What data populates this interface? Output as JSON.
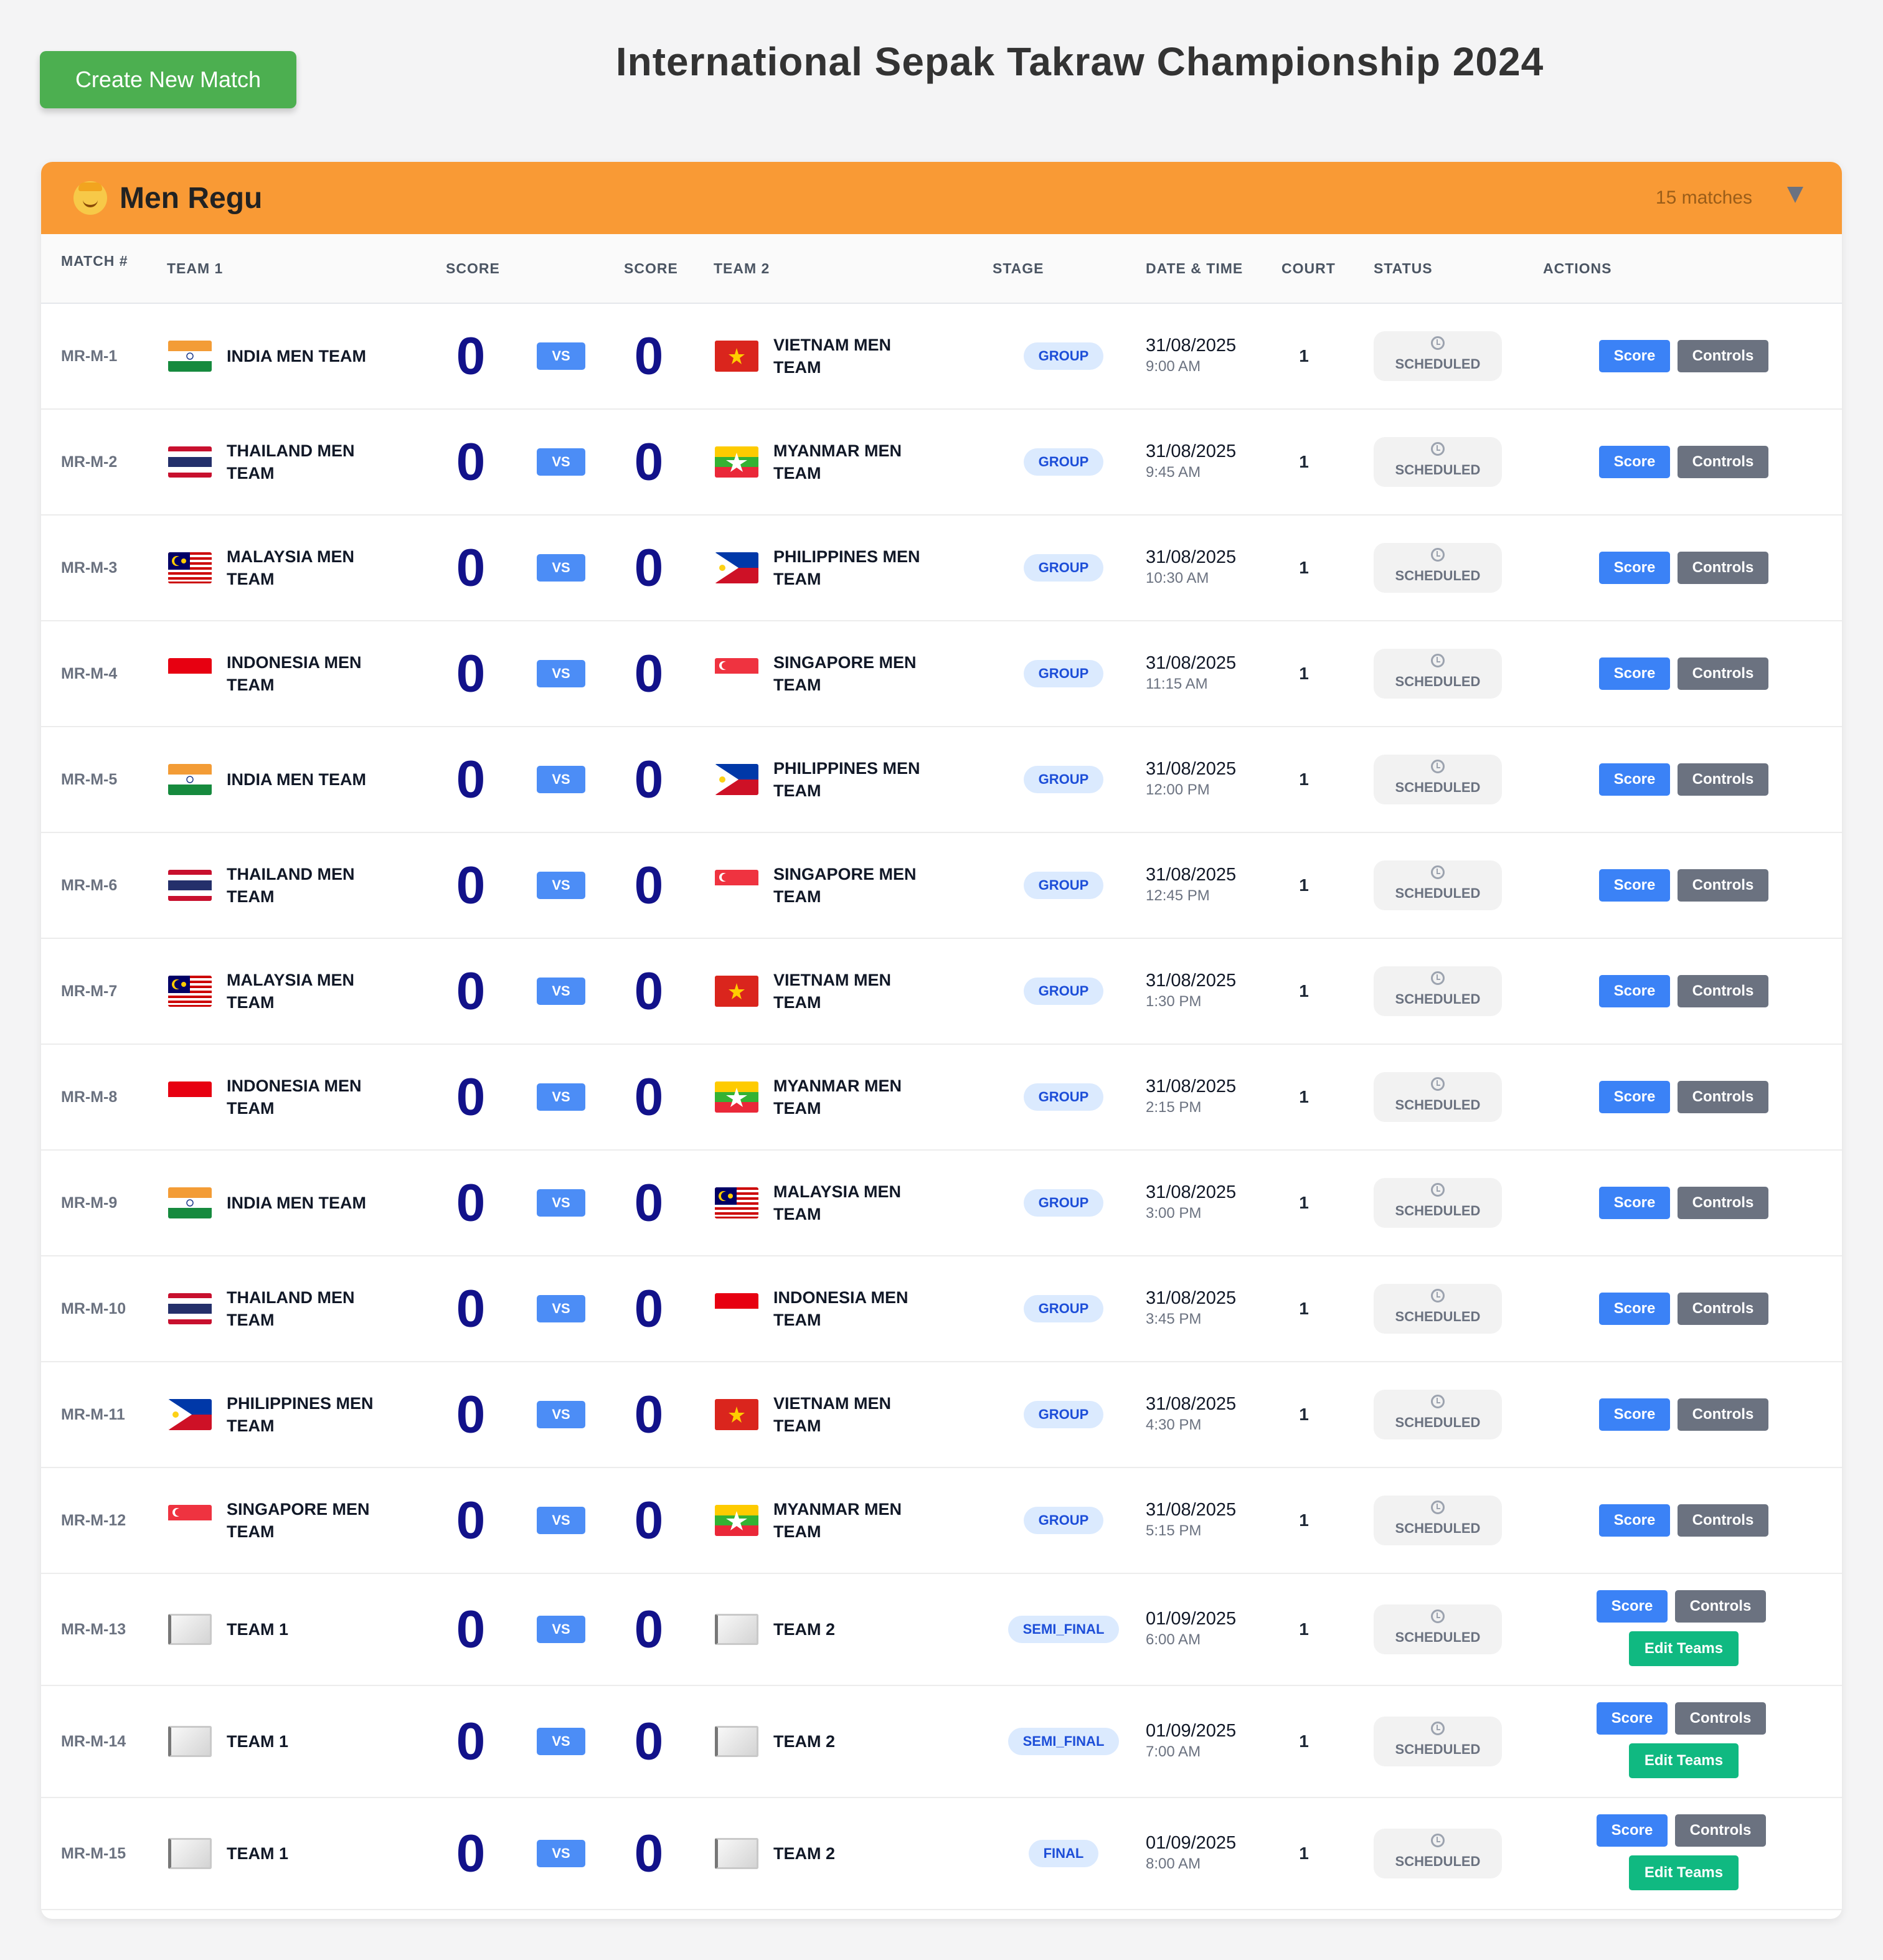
{
  "header": {
    "create_label": "Create New Match",
    "title": "International Sepak Takraw Championship 2024"
  },
  "category": {
    "title": "Men Regu",
    "count": "15 matches",
    "emoji": "man-emoji-icon"
  },
  "columns": {
    "match": "MATCH #",
    "team1": "TEAM 1",
    "score1": "SCORE",
    "score2": "SCORE",
    "team2": "TEAM 2",
    "stage": "STAGE",
    "datetime": "DATE & TIME",
    "court": "COURT",
    "status": "STATUS",
    "actions": "ACTIONS"
  },
  "labels": {
    "vs": "VS",
    "score_btn": "Score",
    "controls_btn": "Controls",
    "edit_btn": "Edit Teams"
  },
  "matches": [
    {
      "id": "MR-M-1",
      "team1": "INDIA MEN TEAM",
      "flag1": "in",
      "score1": "0",
      "score2": "0",
      "team2": "VIETNAM MEN TEAM",
      "flag2": "vn",
      "stage": "GROUP",
      "date": "31/08/2025",
      "time": "9:00 AM",
      "court": "1",
      "status": "SCHEDULED"
    },
    {
      "id": "MR-M-2",
      "team1": "THAILAND MEN TEAM",
      "flag1": "th",
      "score1": "0",
      "score2": "0",
      "team2": "MYANMAR MEN TEAM",
      "flag2": "mm",
      "stage": "GROUP",
      "date": "31/08/2025",
      "time": "9:45 AM",
      "court": "1",
      "status": "SCHEDULED"
    },
    {
      "id": "MR-M-3",
      "team1": "MALAYSIA MEN TEAM",
      "flag1": "my",
      "score1": "0",
      "score2": "0",
      "team2": "PHILIPPINES MEN TEAM",
      "flag2": "ph",
      "stage": "GROUP",
      "date": "31/08/2025",
      "time": "10:30 AM",
      "court": "1",
      "status": "SCHEDULED"
    },
    {
      "id": "MR-M-4",
      "team1": "INDONESIA MEN TEAM",
      "flag1": "id",
      "score1": "0",
      "score2": "0",
      "team2": "SINGAPORE MEN TEAM",
      "flag2": "sg",
      "stage": "GROUP",
      "date": "31/08/2025",
      "time": "11:15 AM",
      "court": "1",
      "status": "SCHEDULED"
    },
    {
      "id": "MR-M-5",
      "team1": "INDIA MEN TEAM",
      "flag1": "in",
      "score1": "0",
      "score2": "0",
      "team2": "PHILIPPINES MEN TEAM",
      "flag2": "ph",
      "stage": "GROUP",
      "date": "31/08/2025",
      "time": "12:00 PM",
      "court": "1",
      "status": "SCHEDULED"
    },
    {
      "id": "MR-M-6",
      "team1": "THAILAND MEN TEAM",
      "flag1": "th",
      "score1": "0",
      "score2": "0",
      "team2": "SINGAPORE MEN TEAM",
      "flag2": "sg",
      "stage": "GROUP",
      "date": "31/08/2025",
      "time": "12:45 PM",
      "court": "1",
      "status": "SCHEDULED"
    },
    {
      "id": "MR-M-7",
      "team1": "MALAYSIA MEN TEAM",
      "flag1": "my",
      "score1": "0",
      "score2": "0",
      "team2": "VIETNAM MEN TEAM",
      "flag2": "vn",
      "stage": "GROUP",
      "date": "31/08/2025",
      "time": "1:30 PM",
      "court": "1",
      "status": "SCHEDULED"
    },
    {
      "id": "MR-M-8",
      "team1": "INDONESIA MEN TEAM",
      "flag1": "id",
      "score1": "0",
      "score2": "0",
      "team2": "MYANMAR MEN TEAM",
      "flag2": "mm",
      "stage": "GROUP",
      "date": "31/08/2025",
      "time": "2:15 PM",
      "court": "1",
      "status": "SCHEDULED"
    },
    {
      "id": "MR-M-9",
      "team1": "INDIA MEN TEAM",
      "flag1": "in",
      "score1": "0",
      "score2": "0",
      "team2": "MALAYSIA MEN TEAM",
      "flag2": "my",
      "stage": "GROUP",
      "date": "31/08/2025",
      "time": "3:00 PM",
      "court": "1",
      "status": "SCHEDULED"
    },
    {
      "id": "MR-M-10",
      "team1": "THAILAND MEN TEAM",
      "flag1": "th",
      "score1": "0",
      "score2": "0",
      "team2": "INDONESIA MEN TEAM",
      "flag2": "id",
      "stage": "GROUP",
      "date": "31/08/2025",
      "time": "3:45 PM",
      "court": "1",
      "status": "SCHEDULED"
    },
    {
      "id": "MR-M-11",
      "team1": "PHILIPPINES MEN TEAM",
      "flag1": "ph",
      "score1": "0",
      "score2": "0",
      "team2": "VIETNAM MEN TEAM",
      "flag2": "vn",
      "stage": "GROUP",
      "date": "31/08/2025",
      "time": "4:30 PM",
      "court": "1",
      "status": "SCHEDULED"
    },
    {
      "id": "MR-M-12",
      "team1": "SINGAPORE MEN TEAM",
      "flag1": "sg",
      "score1": "0",
      "score2": "0",
      "team2": "MYANMAR MEN TEAM",
      "flag2": "mm",
      "stage": "GROUP",
      "date": "31/08/2025",
      "time": "5:15 PM",
      "court": "1",
      "status": "SCHEDULED"
    },
    {
      "id": "MR-M-13",
      "team1": "TEAM 1",
      "flag1": "white",
      "score1": "0",
      "score2": "0",
      "team2": "TEAM 2",
      "flag2": "white",
      "stage": "SEMI_FINAL",
      "date": "01/09/2025",
      "time": "6:00 AM",
      "court": "1",
      "status": "SCHEDULED",
      "editable": true
    },
    {
      "id": "MR-M-14",
      "team1": "TEAM 1",
      "flag1": "white",
      "score1": "0",
      "score2": "0",
      "team2": "TEAM 2",
      "flag2": "white",
      "stage": "SEMI_FINAL",
      "date": "01/09/2025",
      "time": "7:00 AM",
      "court": "1",
      "status": "SCHEDULED",
      "editable": true
    },
    {
      "id": "MR-M-15",
      "team1": "TEAM 1",
      "flag1": "white",
      "score1": "0",
      "score2": "0",
      "team2": "TEAM 2",
      "flag2": "white",
      "stage": "FINAL",
      "date": "01/09/2025",
      "time": "8:00 AM",
      "court": "1",
      "status": "SCHEDULED",
      "editable": true
    }
  ]
}
